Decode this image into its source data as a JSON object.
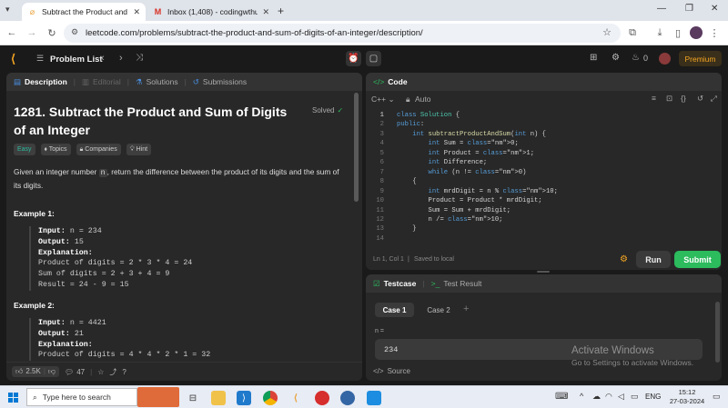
{
  "browser": {
    "tabs": [
      {
        "title": "Subtract the Product and Sum",
        "icon": "leetcode-icon"
      },
      {
        "title": "Inbox (1,408) - codingwthubaid",
        "icon": "gmail-icon"
      }
    ],
    "url": "leetcode.com/problems/subtract-the-product-and-sum-of-digits-of-an-integer/description/"
  },
  "nav": {
    "problem_list": "Problem List",
    "premium": "Premium",
    "fire_count": "0"
  },
  "left": {
    "tabs": [
      "Description",
      "Editorial",
      "Solutions",
      "Submissions"
    ],
    "title": "1281. Subtract the Product and Sum of Digits of an Integer",
    "solved": "Solved",
    "tags": [
      "Easy",
      "Topics",
      "Companies",
      "Hint"
    ],
    "desc_a": "Given an integer number ",
    "desc_n": "n",
    "desc_b": ", return the difference between the product of its digits and the sum of its digits.",
    "ex1": {
      "title": "Example 1:",
      "input": "n = 234",
      "output": "15",
      "expl": "Explanation:",
      "l1": "Product of digits = 2 * 3 * 4 = 24",
      "l2": "Sum of digits = 2 + 3 + 4 = 9",
      "l3": "Result = 24 - 9 = 15"
    },
    "ex2": {
      "title": "Example 2:",
      "input": "n = 4421",
      "output": "21",
      "expl": "Explanation:",
      "l1": "Product of digits = 4 * 4 * 2 * 1 = 32"
    },
    "labels": {
      "input": "Input:",
      "output": "Output:"
    },
    "likes": "2.5K",
    "comments": "47"
  },
  "code": {
    "title": "Code",
    "lang": "C++",
    "auto": "Auto",
    "lines": [
      "class Solution {",
      "public:",
      "    int subtractProductAndSum(int n) {",
      "        int Sum = 0;",
      "        int Product = 1;",
      "        int Difference;",
      "        while (n != 0)",
      "    {",
      "        int mrdDigit = n % 10;",
      "        Product = Product * mrdDigit;",
      "        Sum = Sum + mrdDigit;",
      "        n /= 10;",
      "    }",
      ""
    ],
    "status": "Ln 1, Col 1",
    "saved": "Saved to local",
    "run": "Run",
    "submit": "Submit"
  },
  "test": {
    "tab1": "Testcase",
    "tab2": "Test Result",
    "cases": [
      "Case 1",
      "Case 2"
    ],
    "var": "n =",
    "value": "234",
    "source": "Source"
  },
  "watermark": {
    "l1": "Activate Windows",
    "l2": "Go to Settings to activate Windows."
  },
  "taskbar": {
    "search": "Type here to search",
    "lang": "ENG",
    "time": "15:12",
    "date": "27-03-2024"
  }
}
